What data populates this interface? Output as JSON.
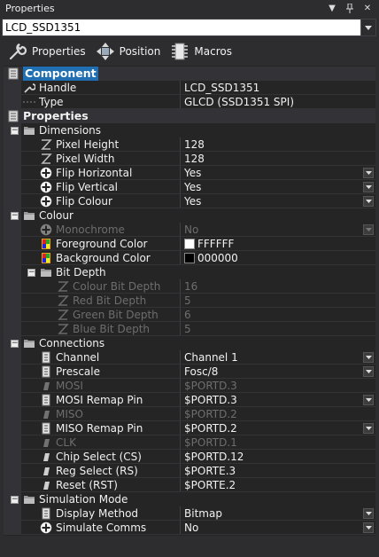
{
  "window": {
    "title": "Properties"
  },
  "selector": {
    "value": "LCD_SSD1351"
  },
  "toolbar": {
    "properties_label": "Properties",
    "position_label": "Position",
    "macros_label": "Macros"
  },
  "rows": [
    {
      "kind": "cat",
      "level": 0,
      "label": "Component",
      "selected": true,
      "icon": "component-icon"
    },
    {
      "kind": "prop",
      "level": 1,
      "label": "Handle",
      "value": "LCD_SSD1351",
      "icon": "wrench-icon"
    },
    {
      "kind": "prop",
      "level": 1,
      "label": "Type",
      "value": "GLCD (SSD1351 SPI)",
      "icon": "dotted-line-icon"
    },
    {
      "kind": "cat",
      "level": 0,
      "label": "Properties",
      "icon": "component-icon"
    },
    {
      "kind": "group",
      "level": 1,
      "label": "Dimensions",
      "expanded": true
    },
    {
      "kind": "prop",
      "level": 2,
      "label": "Pixel Height",
      "value": "128",
      "icon": "z-icon"
    },
    {
      "kind": "prop",
      "level": 2,
      "label": "Pixel Width",
      "value": "128",
      "icon": "z-icon"
    },
    {
      "kind": "prop",
      "level": 2,
      "label": "Flip Horizontal",
      "value": "Yes",
      "icon": "plus-circle-icon",
      "dropdown": true
    },
    {
      "kind": "prop",
      "level": 2,
      "label": "Flip Vertical",
      "value": "Yes",
      "icon": "plus-circle-icon",
      "dropdown": true
    },
    {
      "kind": "prop",
      "level": 2,
      "label": "Flip Colour",
      "value": "Yes",
      "icon": "plus-circle-icon",
      "dropdown": true
    },
    {
      "kind": "group",
      "level": 1,
      "label": "Colour",
      "expanded": true
    },
    {
      "kind": "prop",
      "level": 2,
      "label": "Monochrome",
      "value": "No",
      "icon": "plus-circle-icon",
      "dropdown": true,
      "disabled": true
    },
    {
      "kind": "prop",
      "level": 2,
      "label": "Foreground Color",
      "value": "FFFFFF",
      "icon": "palette-icon",
      "swatch": "#ffffff"
    },
    {
      "kind": "prop",
      "level": 2,
      "label": "Background Color",
      "value": "000000",
      "icon": "palette-icon",
      "swatch": "#000000"
    },
    {
      "kind": "group",
      "level": 2,
      "label": "Bit Depth",
      "expanded": true
    },
    {
      "kind": "prop",
      "level": 3,
      "label": "Colour Bit Depth",
      "value": "16",
      "icon": "z-icon",
      "disabled": true
    },
    {
      "kind": "prop",
      "level": 3,
      "label": "Red Bit Depth",
      "value": "5",
      "icon": "z-icon",
      "disabled": true
    },
    {
      "kind": "prop",
      "level": 3,
      "label": "Green Bit Depth",
      "value": "6",
      "icon": "z-icon",
      "disabled": true
    },
    {
      "kind": "prop",
      "level": 3,
      "label": "Blue Bit Depth",
      "value": "5",
      "icon": "z-icon",
      "disabled": true
    },
    {
      "kind": "group",
      "level": 1,
      "label": "Connections",
      "expanded": true
    },
    {
      "kind": "prop",
      "level": 2,
      "label": "Channel",
      "value": "Channel 1",
      "icon": "list-icon",
      "dropdown": true
    },
    {
      "kind": "prop",
      "level": 2,
      "label": "Prescale",
      "value": "Fosc/8",
      "icon": "list-icon",
      "dropdown": true
    },
    {
      "kind": "prop",
      "level": 2,
      "label": "MOSI",
      "value": "$PORTD.3",
      "icon": "pin-icon",
      "disabled": true
    },
    {
      "kind": "prop",
      "level": 2,
      "label": "MOSI Remap Pin",
      "value": "$PORTD.3",
      "icon": "list-icon",
      "dropdown": true
    },
    {
      "kind": "prop",
      "level": 2,
      "label": "MISO",
      "value": "$PORTD.2",
      "icon": "pin-icon",
      "disabled": true
    },
    {
      "kind": "prop",
      "level": 2,
      "label": "MISO Remap Pin",
      "value": "$PORTD.2",
      "icon": "list-icon",
      "dropdown": true
    },
    {
      "kind": "prop",
      "level": 2,
      "label": "CLK",
      "value": "$PORTD.1",
      "icon": "pin-icon",
      "disabled": true
    },
    {
      "kind": "prop",
      "level": 2,
      "label": "Chip Select (CS)",
      "value": "$PORTD.12",
      "icon": "pin-icon"
    },
    {
      "kind": "prop",
      "level": 2,
      "label": "Reg Select (RS)",
      "value": "$PORTE.3",
      "icon": "pin-icon"
    },
    {
      "kind": "prop",
      "level": 2,
      "label": "Reset (RST)",
      "value": "$PORTE.2",
      "icon": "pin-icon"
    },
    {
      "kind": "group",
      "level": 1,
      "label": "Simulation Mode",
      "expanded": true
    },
    {
      "kind": "prop",
      "level": 2,
      "label": "Display Method",
      "value": "Bitmap",
      "icon": "list-icon",
      "dropdown": true
    },
    {
      "kind": "prop",
      "level": 2,
      "label": "Simulate Comms",
      "value": "No",
      "icon": "plus-circle-icon",
      "dropdown": true
    }
  ]
}
